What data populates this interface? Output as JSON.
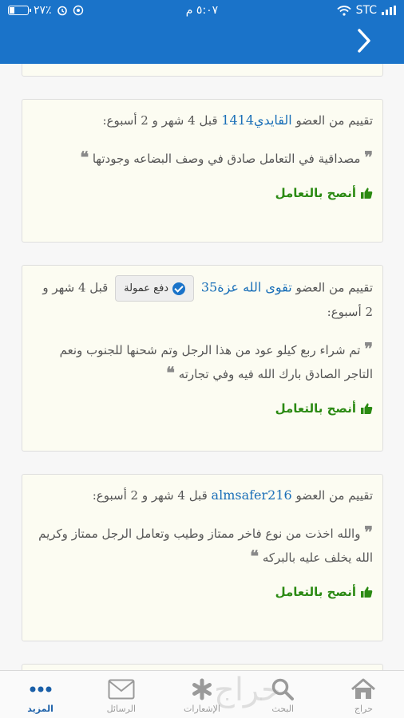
{
  "status_bar": {
    "battery": "٢٧٪",
    "time": "٥:٠٧ م",
    "carrier": "STC",
    "battery_level_percent": 27
  },
  "reviews": [
    {
      "prefix": "تقييم من العضو",
      "username": "القايدي1414",
      "when": "قبل 4 شهر و 2 أسبوع:",
      "text": "مصداقية في التعامل صادق في وصف البضاعه وجودتها",
      "recommend": "أنصح بالتعامل"
    },
    {
      "prefix": "تقييم من العضو",
      "username": "تقوى الله عزة35",
      "badge": "دفع عمولة",
      "when": "قبل 4 شهر و 2 أسبوع:",
      "text": "تم شراء ربع كيلو عود من هذا الرجل وتم شحنها للجنوب ونعم التاجر الصادق بارك الله فيه وفي تجارته",
      "recommend": "أنصح بالتعامل"
    },
    {
      "prefix": "تقييم من العضو",
      "username": "almsafer216",
      "when": "قبل 4 شهر و 2 أسبوع:",
      "text": "والله اخذت من نوع فاخر ممتاز وطيب وتعامل الرجل ممتاز وكريم الله يخلف عليه بالبركه",
      "recommend": "أنصح بالتعامل"
    }
  ],
  "tabs": [
    {
      "label": "المزيد",
      "icon": "more-dots-icon",
      "active": true
    },
    {
      "label": "الرسائل",
      "icon": "envelope-icon"
    },
    {
      "label": "الإشعارات",
      "icon": "asterisk-icon"
    },
    {
      "label": "البحث",
      "icon": "search-icon"
    },
    {
      "label": "حراج",
      "icon": "home-icon"
    }
  ],
  "watermark": "حراج",
  "colors": {
    "header": "#1a73c9",
    "link": "#1a6fb8",
    "recommend": "#2b8a13",
    "active_tab": "#1a5fa8"
  }
}
